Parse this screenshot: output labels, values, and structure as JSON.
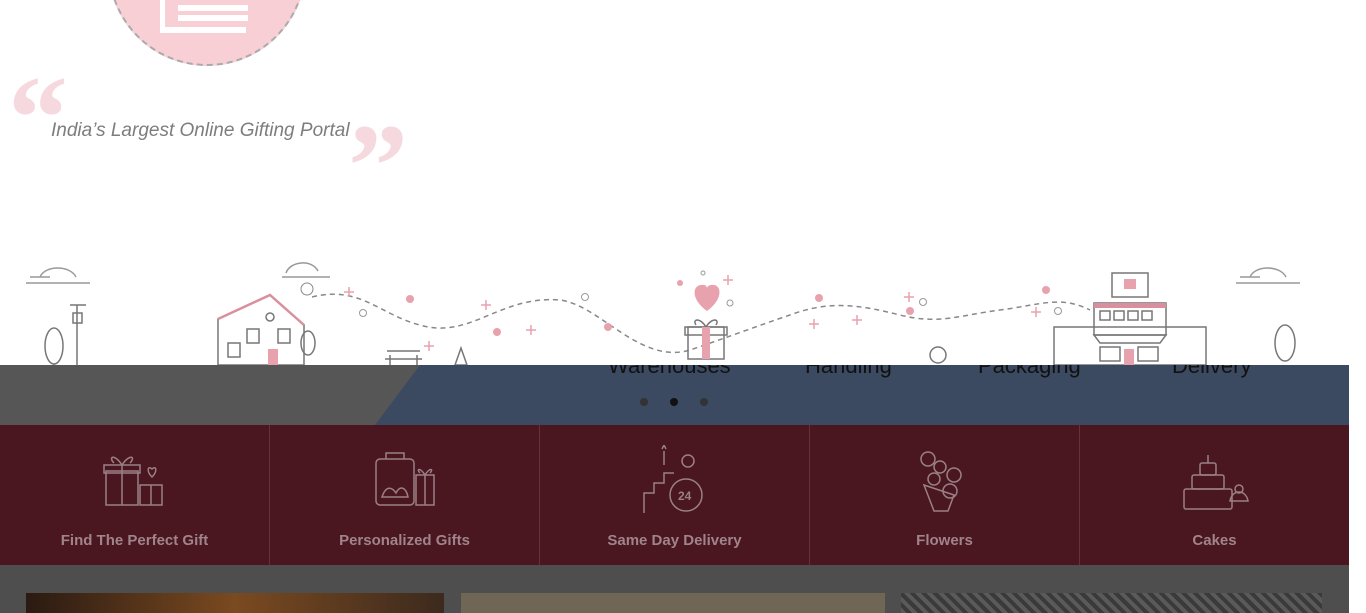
{
  "hero": {
    "tagline": "India’s Largest Online Gifting Portal"
  },
  "slider": {
    "steps": [
      "Warehouses",
      "Handling",
      "Packaging",
      "Delivery"
    ],
    "dots": 3,
    "active_dot": 2
  },
  "categories": [
    {
      "label": "Find The Perfect Gift",
      "icon": "gift-icon"
    },
    {
      "label": "Personalized Gifts",
      "icon": "personalized-gift-icon"
    },
    {
      "label": "Same Day Delivery",
      "icon": "same-day-delivery-icon"
    },
    {
      "label": "Flowers",
      "icon": "flowers-icon"
    },
    {
      "label": "Cakes",
      "icon": "cake-icon"
    }
  ],
  "colors": {
    "category_bg": "#4a1620",
    "accent_pink": "#e8a2ae",
    "slider_blue": "#3b4a60"
  }
}
